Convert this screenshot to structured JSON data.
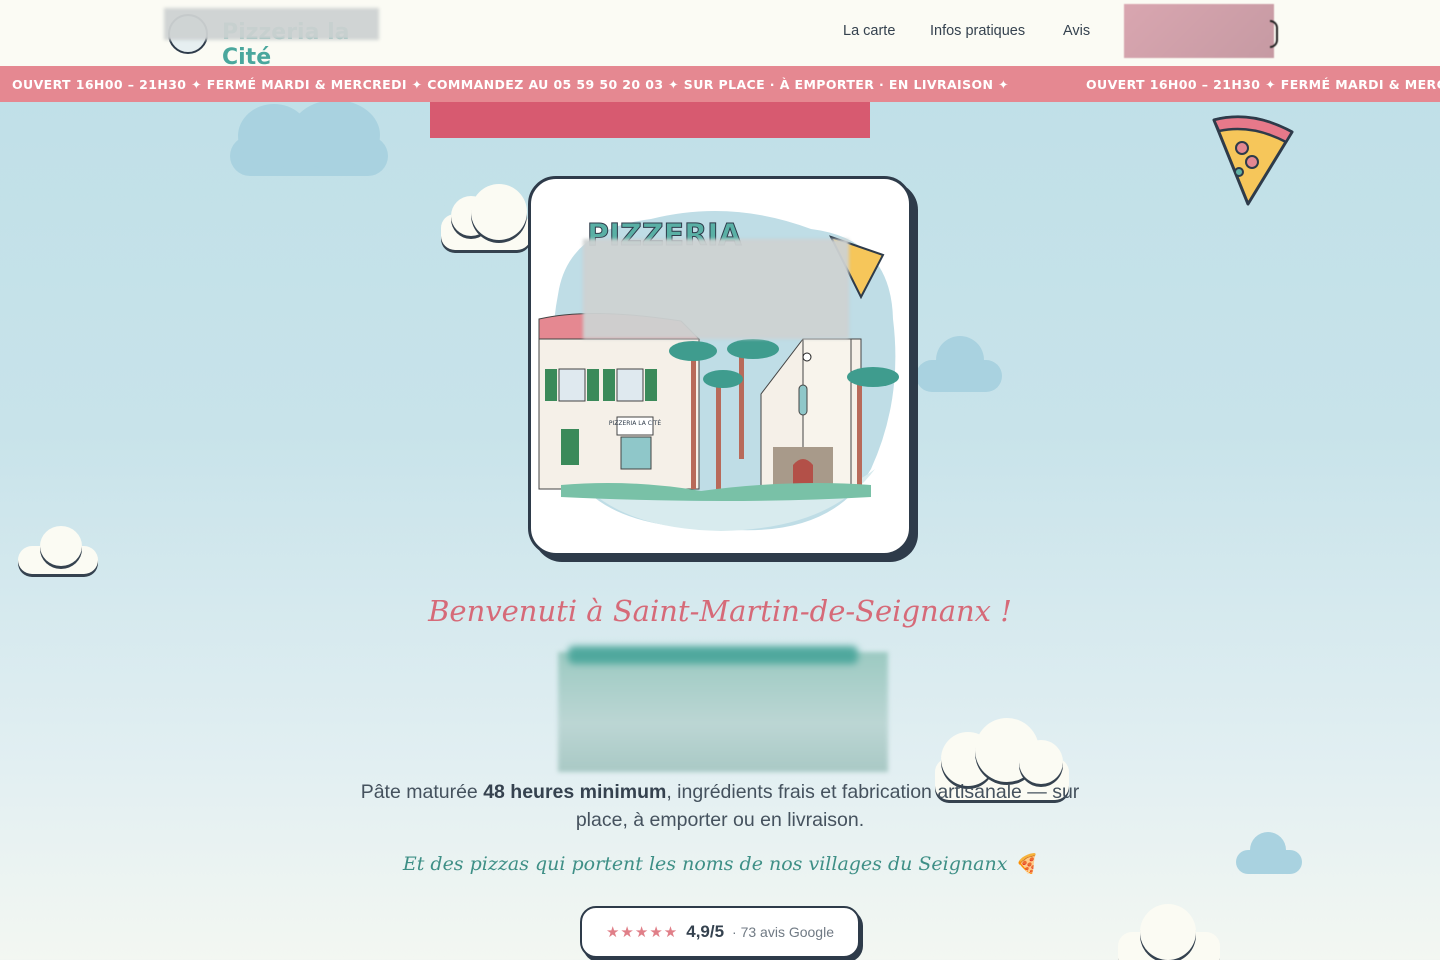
{
  "header": {
    "logo_text": "Pizzeria la Cité",
    "nav": [
      "La carte",
      "Infos pratiques",
      "Avis"
    ]
  },
  "ticker": {
    "text": "OUVERT 16H00 – 21H30 ✦ FERMÉ MARDI & MERCREDI ✦ COMMANDEZ AU 05 59 50 20 03 ✦ SUR PLACE · À EMPORTER · EN LIVRAISON ✦"
  },
  "hero": {
    "illustration_sign": "PIZZERIA LA CITÉ",
    "tagline": "Benvenuti à Saint-Martin-de-Seignanx !",
    "desc_before": "Pâte maturée ",
    "desc_bold": "48 heures minimum",
    "desc_after": ", ingrédients frais et fabrication artisanale — sur place, à emporter ou en livraison.",
    "sub": "Et des pizzas qui portent les noms de nos villages du Seignanx 🍕"
  },
  "rating": {
    "stars": "★★★★★",
    "score": "4,9/5",
    "count": "· 73 avis Google"
  },
  "colors": {
    "accent": "#e58891",
    "brand_red": "#d75a70",
    "teal": "#4aa79d",
    "ink": "#2e3b4a"
  }
}
